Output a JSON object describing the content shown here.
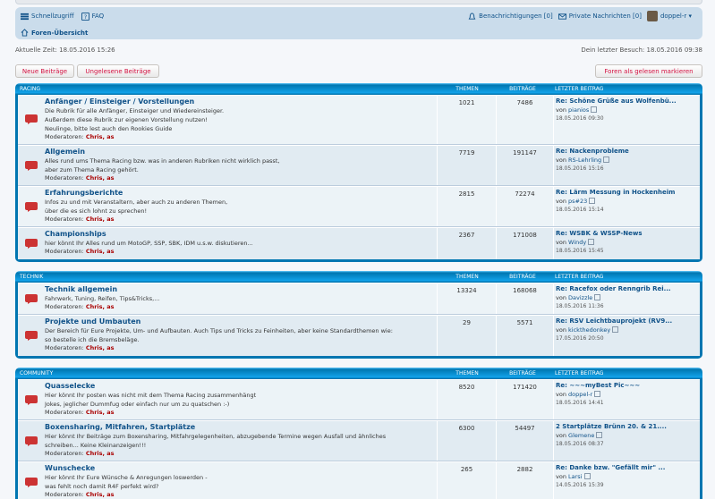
{
  "nav": {
    "quicklinks": "Schnellzugriff",
    "faq": "FAQ",
    "notifications": "Benachrichtigungen",
    "notifications_count": "0",
    "pm": "Private Nachrichten",
    "pm_count": "0",
    "username": "doppel-r",
    "breadcrumb": "Foren-Übersicht"
  },
  "times": {
    "current": "Aktuelle Zeit: 18.05.2016 15:26",
    "last_visit": "Dein letzter Besuch: 18.05.2016 09:38"
  },
  "buttons": {
    "new_posts": "Neue Beiträge",
    "unread_posts": "Ungelesene Beiträge",
    "mark_read": "Foren als gelesen markieren"
  },
  "columns": {
    "topics": "THEMEN",
    "posts": "BEITRÄGE",
    "last": "LETZTER BEITRAG"
  },
  "mods_label": "Moderatoren:",
  "mods_names": "Chris, as",
  "by": "von",
  "categories": [
    {
      "name": "RACING",
      "forums": [
        {
          "title": "Anfänger / Einsteiger / Vorstellungen",
          "desc": [
            "Die Rubrik für alle Anfänger, Einsteiger und Wiedereinsteiger.",
            "Außerdem diese Rubrik zur eigenen Vorstellung nutzen!",
            "Neulinge, bitte lest auch den Rookies Guide"
          ],
          "topics": "1021",
          "posts": "7486",
          "last_title": "Re: Schöne Grüße aus Wolfenbü...",
          "last_user": "pianios",
          "last_date": "18.05.2016 09:30"
        },
        {
          "title": "Allgemein",
          "desc": [
            "Alles rund ums Thema Racing bzw. was in anderen Rubriken nicht wirklich passt,",
            "aber zum Thema Racing gehört."
          ],
          "topics": "7719",
          "posts": "191147",
          "last_title": "Re: Nackenprobleme",
          "last_user": "RS-Lehrling",
          "last_date": "18.05.2016 15:16"
        },
        {
          "title": "Erfahrungsberichte",
          "desc": [
            "Infos zu und mit Veranstaltern, aber auch zu anderen Themen,",
            "über die es sich lohnt zu sprechen!"
          ],
          "topics": "2815",
          "posts": "72274",
          "last_title": "Re: Lärm Messung in Hockenheim",
          "last_user": "ps#23",
          "last_date": "18.05.2016 15:14"
        },
        {
          "title": "Championships",
          "desc": [
            "hier könnt Ihr Alles rund um MotoGP, SSP, SBK, IDM u.s.w. diskutieren..."
          ],
          "topics": "2367",
          "posts": "171008",
          "last_title": "Re: WSBK & WSSP-News",
          "last_user": "Windy",
          "last_date": "18.05.2016 15:45"
        }
      ]
    },
    {
      "name": "TECHNIK",
      "forums": [
        {
          "title": "Technik allgemein",
          "desc": [
            "Fahrwerk, Tuning, Reifen, Tips&Tricks,..."
          ],
          "topics": "13324",
          "posts": "168068",
          "last_title": "Re: Racefox oder Renngrib Rei...",
          "last_user": "Davizzle",
          "last_date": "18.05.2016 11:36"
        },
        {
          "title": "Projekte und Umbauten",
          "desc": [
            "Der Bereich für Eure Projekte, Um- und Aufbauten. Auch Tips und Tricks zu Feinheiten, aber keine Standardthemen wie:",
            "so bestelle ich die Bremsbeläge."
          ],
          "topics": "29",
          "posts": "5571",
          "last_title": "Re: RSV Leichtbauprojekt (RV9...",
          "last_user": "kickthedonkey",
          "last_date": "17.05.2016 20:50"
        }
      ]
    },
    {
      "name": "COMMUNITY",
      "forums": [
        {
          "title": "Quasselecke",
          "desc": [
            "Hier könnt Ihr posten was nicht mit dem Thema Racing zusammenhängt",
            "Jokes, jeglicher Dummfug oder einfach nur um zu quatschen :-)"
          ],
          "topics": "8520",
          "posts": "171420",
          "last_title": "Re: ~~~myBest Pic~~~",
          "last_user": "doppel-r",
          "last_date": "18.05.2016 14:41"
        },
        {
          "title": "Boxensharing, Mitfahren, Startplätze",
          "desc": [
            "Hier könnt Ihr Beiträge zum Boxensharing, Mitfahrgelegenheiten, abzugebende Termine wegen Ausfall und ähnliches",
            "schreiben... Keine Kleinanzeigen!!!"
          ],
          "topics": "6300",
          "posts": "54497",
          "last_title": "2 Startplätze Brünn 20. & 21....",
          "last_user": "Glemene",
          "last_date": "18.05.2016 08:37"
        },
        {
          "title": "Wunschecke",
          "desc": [
            "Hier könnt Ihr Eure Wünsche & Anregungen loswerden -",
            "was fehlt noch damit R4F perfekt wird?"
          ],
          "topics": "265",
          "posts": "2882",
          "last_title": "Re: Danke bzw. \"Gefällt mir\" ...",
          "last_user": "Larsi",
          "last_date": "14.05.2016 15:39"
        }
      ]
    }
  ]
}
